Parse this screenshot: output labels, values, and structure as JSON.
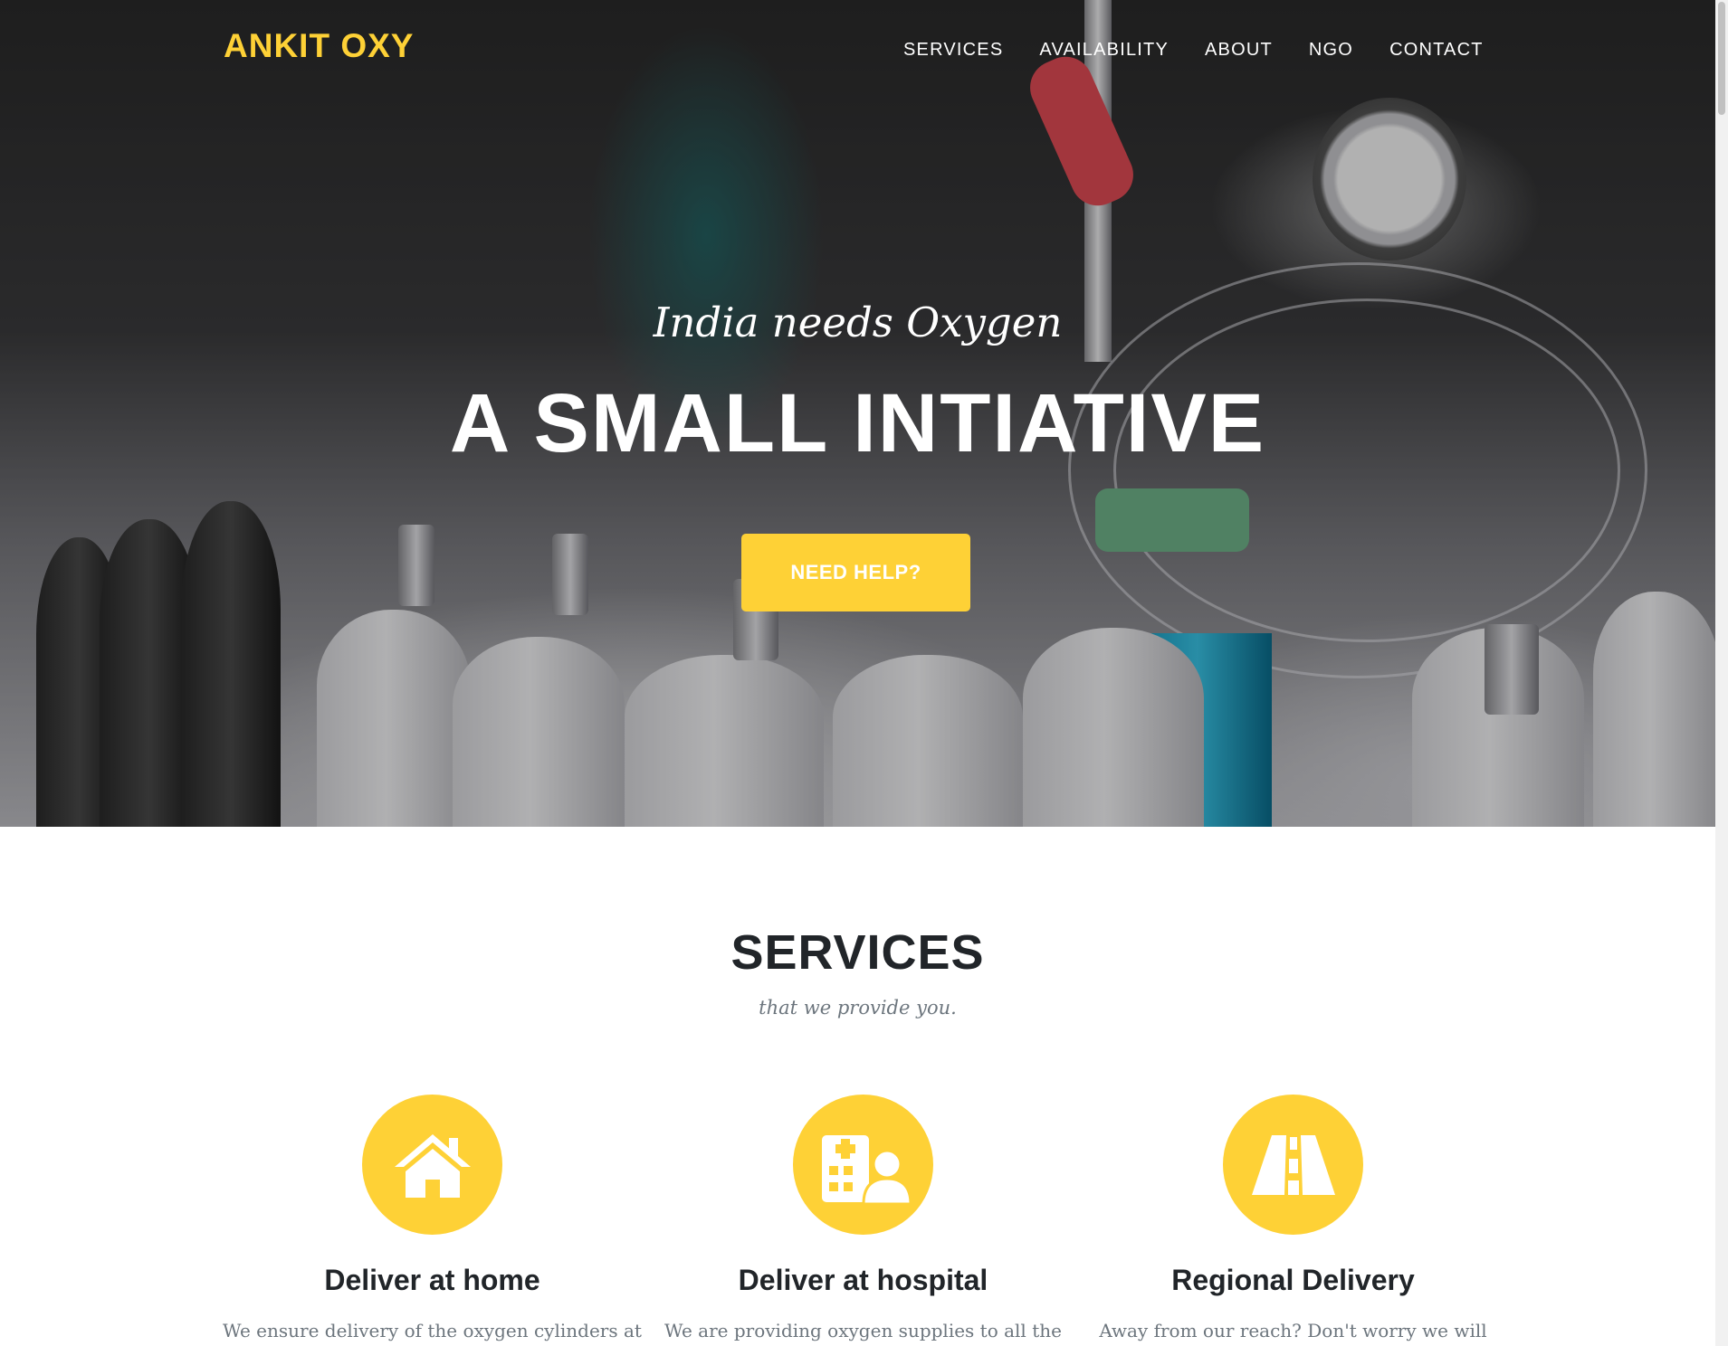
{
  "brand": "ANKIT OXY",
  "nav": {
    "items": [
      "SERVICES",
      "AVAILABILITY",
      "ABOUT",
      "NGO",
      "CONTACT"
    ]
  },
  "hero": {
    "subtitle": "India needs Oxygen",
    "title": "A SMALL INTIATIVE",
    "button_label": "NEED HELP?"
  },
  "services": {
    "heading": "SERVICES",
    "subheading": "that we provide you.",
    "items": [
      {
        "icon": "home-icon",
        "title": "Deliver at home",
        "text": "We ensure delivery of the oxygen cylinders at"
      },
      {
        "icon": "hospital-user-icon",
        "title": "Deliver at hospital",
        "text": "We are providing oxygen supplies to all the"
      },
      {
        "icon": "road-icon",
        "title": "Regional Delivery",
        "text": "Away from our reach? Don't worry we will"
      }
    ]
  },
  "colors": {
    "accent": "#fed136",
    "heading": "#212529",
    "muted": "#6c757d"
  }
}
